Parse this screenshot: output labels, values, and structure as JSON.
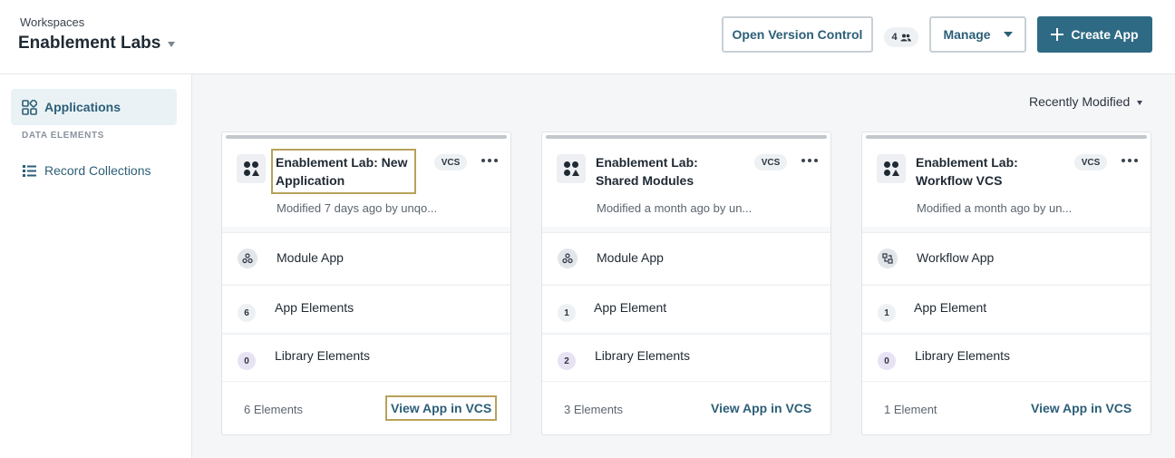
{
  "header": {
    "workspace_label": "Workspaces",
    "workspace_name": "Enablement Labs",
    "open_version_control": "Open Version Control",
    "users_count": "4",
    "manage": "Manage",
    "create_app": "Create App"
  },
  "sidebar": {
    "applications": "Applications",
    "section_data": "DATA ELEMENTS",
    "record_collections": "Record Collections"
  },
  "sort": {
    "label": "Recently Modified"
  },
  "cards": [
    {
      "title": "Enablement Lab: New Application",
      "subtitle": "Modified 7 days ago by unqo...",
      "badge": "VCS",
      "type": "Module App",
      "elements_count": "6",
      "elements_label": "App Elements",
      "library_count": "0",
      "library_label": "Library Elements",
      "footer_count": "6 Elements",
      "footer_link": "View App in VCS"
    },
    {
      "title": "Enablement Lab: Shared Modules",
      "subtitle": "Modified a month ago by un...",
      "badge": "VCS",
      "type": "Module App",
      "elements_count": "1",
      "elements_label": "App Element",
      "library_count": "2",
      "library_label": "Library Elements",
      "footer_count": "3 Elements",
      "footer_link": "View App in VCS"
    },
    {
      "title": "Enablement Lab: Workflow VCS",
      "subtitle": "Modified a month ago by un...",
      "badge": "VCS",
      "type": "Workflow App",
      "elements_count": "1",
      "elements_label": "App Element",
      "library_count": "0",
      "library_label": "Library Elements",
      "footer_count": "1 Element",
      "footer_link": "View App in VCS"
    }
  ],
  "colors": {
    "accent": "#2f6a84",
    "link": "#2c5f77",
    "highlight": "#b8a25a"
  }
}
